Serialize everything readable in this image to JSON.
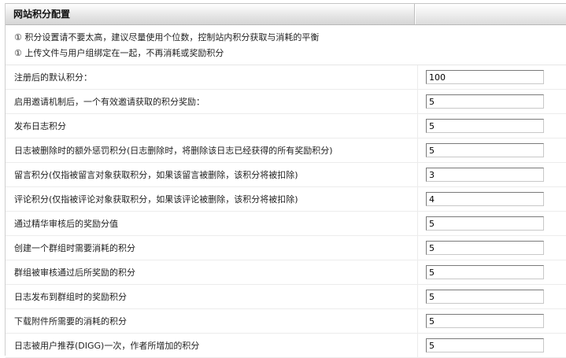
{
  "header": {
    "title": "网站积分配置"
  },
  "notes": [
    "① 积分设置请不要太高，建议尽量使用个位数，控制站内积分获取与消耗的平衡",
    "① 上传文件与用户组绑定在一起，不再消耗或奖励积分"
  ],
  "rows": [
    {
      "label": "注册后的默认积分：",
      "value": "100"
    },
    {
      "label": "启用邀请机制后，一个有效邀请获取的积分奖励：",
      "value": "5"
    },
    {
      "label": "发布日志积分",
      "value": "5"
    },
    {
      "label": "日志被删除时的额外惩罚积分(日志删除时，将删除该日志已经获得的所有奖励积分)",
      "value": "5"
    },
    {
      "label": "留言积分(仅指被留言对象获取积分，如果该留言被删除，该积分将被扣除)",
      "value": "3"
    },
    {
      "label": "评论积分(仅指被评论对象获取积分，如果该评论被删除，该积分将被扣除)",
      "value": "4"
    },
    {
      "label": "通过精华审核后的奖励分值",
      "value": "5"
    },
    {
      "label": "创建一个群组时需要消耗的积分",
      "value": "5"
    },
    {
      "label": "群组被审核通过后所奖励的积分",
      "value": "5"
    },
    {
      "label": "日志发布到群组时的奖励积分",
      "value": "5"
    },
    {
      "label": "下载附件所需要的消耗的积分",
      "value": "5"
    },
    {
      "label": "日志被用户推荐(DIGG)一次，作者所增加的积分",
      "value": "5"
    }
  ]
}
